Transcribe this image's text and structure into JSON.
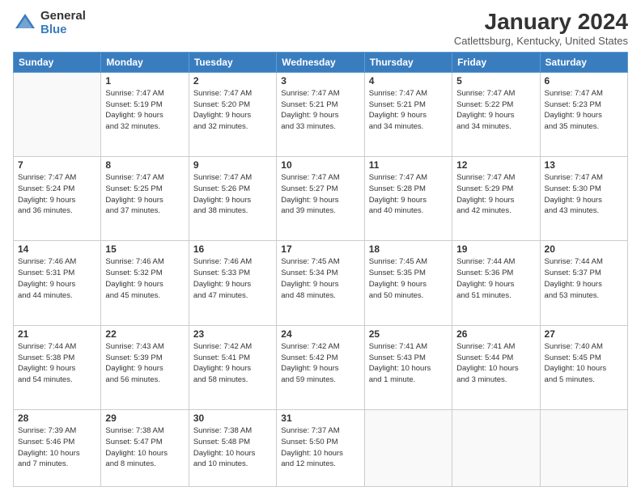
{
  "logo": {
    "general": "General",
    "blue": "Blue"
  },
  "title": "January 2024",
  "location": "Catlettsburg, Kentucky, United States",
  "headers": [
    "Sunday",
    "Monday",
    "Tuesday",
    "Wednesday",
    "Thursday",
    "Friday",
    "Saturday"
  ],
  "weeks": [
    [
      {
        "day": "",
        "info": ""
      },
      {
        "day": "1",
        "info": "Sunrise: 7:47 AM\nSunset: 5:19 PM\nDaylight: 9 hours\nand 32 minutes."
      },
      {
        "day": "2",
        "info": "Sunrise: 7:47 AM\nSunset: 5:20 PM\nDaylight: 9 hours\nand 32 minutes."
      },
      {
        "day": "3",
        "info": "Sunrise: 7:47 AM\nSunset: 5:21 PM\nDaylight: 9 hours\nand 33 minutes."
      },
      {
        "day": "4",
        "info": "Sunrise: 7:47 AM\nSunset: 5:21 PM\nDaylight: 9 hours\nand 34 minutes."
      },
      {
        "day": "5",
        "info": "Sunrise: 7:47 AM\nSunset: 5:22 PM\nDaylight: 9 hours\nand 34 minutes."
      },
      {
        "day": "6",
        "info": "Sunrise: 7:47 AM\nSunset: 5:23 PM\nDaylight: 9 hours\nand 35 minutes."
      }
    ],
    [
      {
        "day": "7",
        "info": "Sunrise: 7:47 AM\nSunset: 5:24 PM\nDaylight: 9 hours\nand 36 minutes."
      },
      {
        "day": "8",
        "info": "Sunrise: 7:47 AM\nSunset: 5:25 PM\nDaylight: 9 hours\nand 37 minutes."
      },
      {
        "day": "9",
        "info": "Sunrise: 7:47 AM\nSunset: 5:26 PM\nDaylight: 9 hours\nand 38 minutes."
      },
      {
        "day": "10",
        "info": "Sunrise: 7:47 AM\nSunset: 5:27 PM\nDaylight: 9 hours\nand 39 minutes."
      },
      {
        "day": "11",
        "info": "Sunrise: 7:47 AM\nSunset: 5:28 PM\nDaylight: 9 hours\nand 40 minutes."
      },
      {
        "day": "12",
        "info": "Sunrise: 7:47 AM\nSunset: 5:29 PM\nDaylight: 9 hours\nand 42 minutes."
      },
      {
        "day": "13",
        "info": "Sunrise: 7:47 AM\nSunset: 5:30 PM\nDaylight: 9 hours\nand 43 minutes."
      }
    ],
    [
      {
        "day": "14",
        "info": "Sunrise: 7:46 AM\nSunset: 5:31 PM\nDaylight: 9 hours\nand 44 minutes."
      },
      {
        "day": "15",
        "info": "Sunrise: 7:46 AM\nSunset: 5:32 PM\nDaylight: 9 hours\nand 45 minutes."
      },
      {
        "day": "16",
        "info": "Sunrise: 7:46 AM\nSunset: 5:33 PM\nDaylight: 9 hours\nand 47 minutes."
      },
      {
        "day": "17",
        "info": "Sunrise: 7:45 AM\nSunset: 5:34 PM\nDaylight: 9 hours\nand 48 minutes."
      },
      {
        "day": "18",
        "info": "Sunrise: 7:45 AM\nSunset: 5:35 PM\nDaylight: 9 hours\nand 50 minutes."
      },
      {
        "day": "19",
        "info": "Sunrise: 7:44 AM\nSunset: 5:36 PM\nDaylight: 9 hours\nand 51 minutes."
      },
      {
        "day": "20",
        "info": "Sunrise: 7:44 AM\nSunset: 5:37 PM\nDaylight: 9 hours\nand 53 minutes."
      }
    ],
    [
      {
        "day": "21",
        "info": "Sunrise: 7:44 AM\nSunset: 5:38 PM\nDaylight: 9 hours\nand 54 minutes."
      },
      {
        "day": "22",
        "info": "Sunrise: 7:43 AM\nSunset: 5:39 PM\nDaylight: 9 hours\nand 56 minutes."
      },
      {
        "day": "23",
        "info": "Sunrise: 7:42 AM\nSunset: 5:41 PM\nDaylight: 9 hours\nand 58 minutes."
      },
      {
        "day": "24",
        "info": "Sunrise: 7:42 AM\nSunset: 5:42 PM\nDaylight: 9 hours\nand 59 minutes."
      },
      {
        "day": "25",
        "info": "Sunrise: 7:41 AM\nSunset: 5:43 PM\nDaylight: 10 hours\nand 1 minute."
      },
      {
        "day": "26",
        "info": "Sunrise: 7:41 AM\nSunset: 5:44 PM\nDaylight: 10 hours\nand 3 minutes."
      },
      {
        "day": "27",
        "info": "Sunrise: 7:40 AM\nSunset: 5:45 PM\nDaylight: 10 hours\nand 5 minutes."
      }
    ],
    [
      {
        "day": "28",
        "info": "Sunrise: 7:39 AM\nSunset: 5:46 PM\nDaylight: 10 hours\nand 7 minutes."
      },
      {
        "day": "29",
        "info": "Sunrise: 7:38 AM\nSunset: 5:47 PM\nDaylight: 10 hours\nand 8 minutes."
      },
      {
        "day": "30",
        "info": "Sunrise: 7:38 AM\nSunset: 5:48 PM\nDaylight: 10 hours\nand 10 minutes."
      },
      {
        "day": "31",
        "info": "Sunrise: 7:37 AM\nSunset: 5:50 PM\nDaylight: 10 hours\nand 12 minutes."
      },
      {
        "day": "",
        "info": ""
      },
      {
        "day": "",
        "info": ""
      },
      {
        "day": "",
        "info": ""
      }
    ]
  ]
}
